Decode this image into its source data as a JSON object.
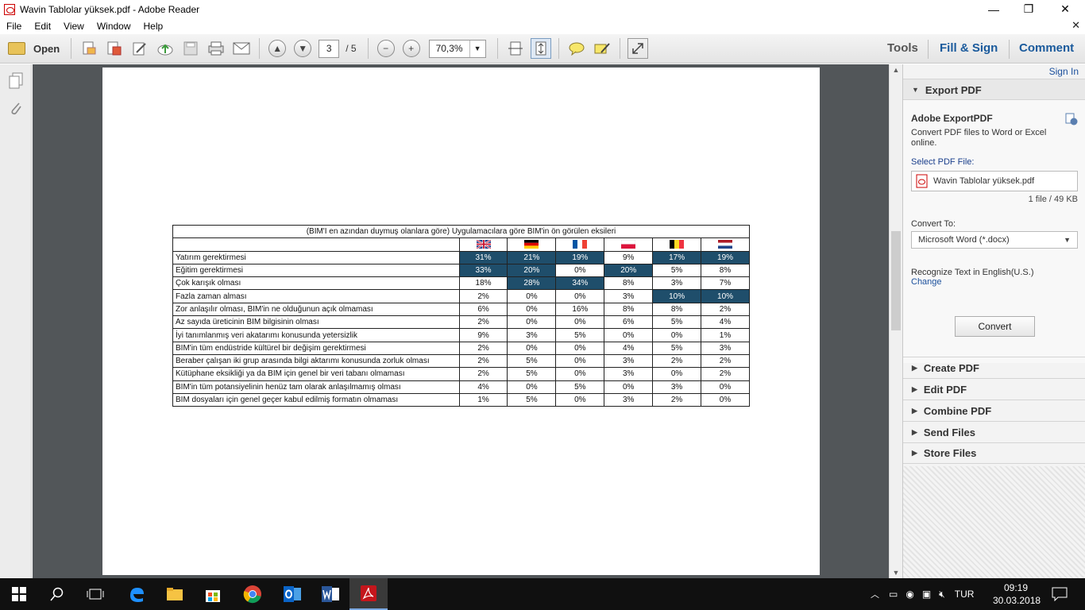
{
  "window": {
    "title": "Wavin Tablolar yüksek.pdf - Adobe Reader",
    "min": "—",
    "max": "❐",
    "close": "✕"
  },
  "menu": [
    "File",
    "Edit",
    "View",
    "Window",
    "Help"
  ],
  "menu_close": "✕",
  "toolbar": {
    "open_label": "Open",
    "page_current": "3",
    "page_total": "/ 5",
    "zoom": "70,3%"
  },
  "right_tabs": {
    "tools": "Tools",
    "fill_sign": "Fill & Sign",
    "comment": "Comment"
  },
  "right_panel": {
    "sign_in": "Sign In",
    "export_title": "Export PDF",
    "adobe_title": "Adobe ExportPDF",
    "description": "Convert PDF files to Word or Excel online.",
    "select_label": "Select PDF File:",
    "file_name": "Wavin Tablolar yüksek.pdf",
    "file_info": "1 file / 49 KB",
    "convert_to_label": "Convert To:",
    "convert_format": "Microsoft Word (*.docx)",
    "recognize_text": "Recognize Text in English(U.S.)",
    "change_link": "Change",
    "convert_button": "Convert",
    "sections": [
      "Create PDF",
      "Edit PDF",
      "Combine PDF",
      "Send Files",
      "Store Files"
    ]
  },
  "table": {
    "title": "(BIM'I en azından duymuş olanlara göre) Uygulamacılara göre BIM'in ön görülen eksileri",
    "flags": [
      "uk",
      "de",
      "fr",
      "pl",
      "be",
      "nl"
    ],
    "rows": [
      {
        "label": "Yatırım gerektirmesi",
        "values": [
          "31%",
          "21%",
          "19%",
          "9%",
          "17%",
          "19%"
        ],
        "hl": [
          true,
          true,
          true,
          false,
          true,
          true
        ]
      },
      {
        "label": "Eğitim gerektirmesi",
        "values": [
          "33%",
          "20%",
          "0%",
          "20%",
          "5%",
          "8%"
        ],
        "hl": [
          true,
          true,
          false,
          true,
          false,
          false
        ]
      },
      {
        "label": "Çok karışık olması",
        "values": [
          "18%",
          "28%",
          "34%",
          "8%",
          "3%",
          "7%"
        ],
        "hl": [
          false,
          true,
          true,
          false,
          false,
          false
        ]
      },
      {
        "label": "Fazla zaman alması",
        "values": [
          "2%",
          "0%",
          "0%",
          "3%",
          "10%",
          "10%"
        ],
        "hl": [
          false,
          false,
          false,
          false,
          true,
          true
        ]
      },
      {
        "label": "Zor anlaşılır olması, BIM'in ne olduğunun açık olmaması",
        "values": [
          "6%",
          "0%",
          "16%",
          "8%",
          "8%",
          "2%"
        ],
        "hl": [
          false,
          false,
          false,
          false,
          false,
          false
        ]
      },
      {
        "label": "Az sayıda üreticinin BIM bilgisinin olması",
        "values": [
          "2%",
          "0%",
          "0%",
          "6%",
          "5%",
          "4%"
        ],
        "hl": [
          false,
          false,
          false,
          false,
          false,
          false
        ]
      },
      {
        "label": "İyi tanımlanmış veri akatarımı konusunda yetersizlik",
        "values": [
          "9%",
          "3%",
          "5%",
          "0%",
          "0%",
          "1%"
        ],
        "hl": [
          false,
          false,
          false,
          false,
          false,
          false
        ]
      },
      {
        "label": "BIM'in tüm endüstride kültürel bir değişim gerektirmesi",
        "values": [
          "2%",
          "0%",
          "0%",
          "4%",
          "5%",
          "3%"
        ],
        "hl": [
          false,
          false,
          false,
          false,
          false,
          false
        ]
      },
      {
        "label": "Beraber çalışan iki grup arasında bilgi aktarımı konusunda zorluk olması",
        "values": [
          "2%",
          "5%",
          "0%",
          "3%",
          "2%",
          "2%"
        ],
        "hl": [
          false,
          false,
          false,
          false,
          false,
          false
        ]
      },
      {
        "label": "Kütüphane eksikliği ya da BIM için genel bir veri tabanı olmaması",
        "values": [
          "2%",
          "5%",
          "0%",
          "3%",
          "0%",
          "2%"
        ],
        "hl": [
          false,
          false,
          false,
          false,
          false,
          false
        ]
      },
      {
        "label": "BIM'in tüm potansiyelinin henüz tam olarak anlaşılmamış olması",
        "values": [
          "4%",
          "0%",
          "5%",
          "0%",
          "3%",
          "0%"
        ],
        "hl": [
          false,
          false,
          false,
          false,
          false,
          false
        ]
      },
      {
        "label": "BIM dosyaları için genel geçer kabul edilmiş formatın olmaması",
        "values": [
          "1%",
          "5%",
          "0%",
          "3%",
          "2%",
          "0%"
        ],
        "hl": [
          false,
          false,
          false,
          false,
          false,
          false
        ]
      }
    ]
  },
  "taskbar": {
    "lang": "TUR",
    "time": "09:19",
    "date": "30.03.2018"
  },
  "colors": {
    "highlight": "#1f4e6b",
    "doc_bg": "#525659",
    "taskbar": "#101010",
    "link": "#1a4f9c"
  }
}
